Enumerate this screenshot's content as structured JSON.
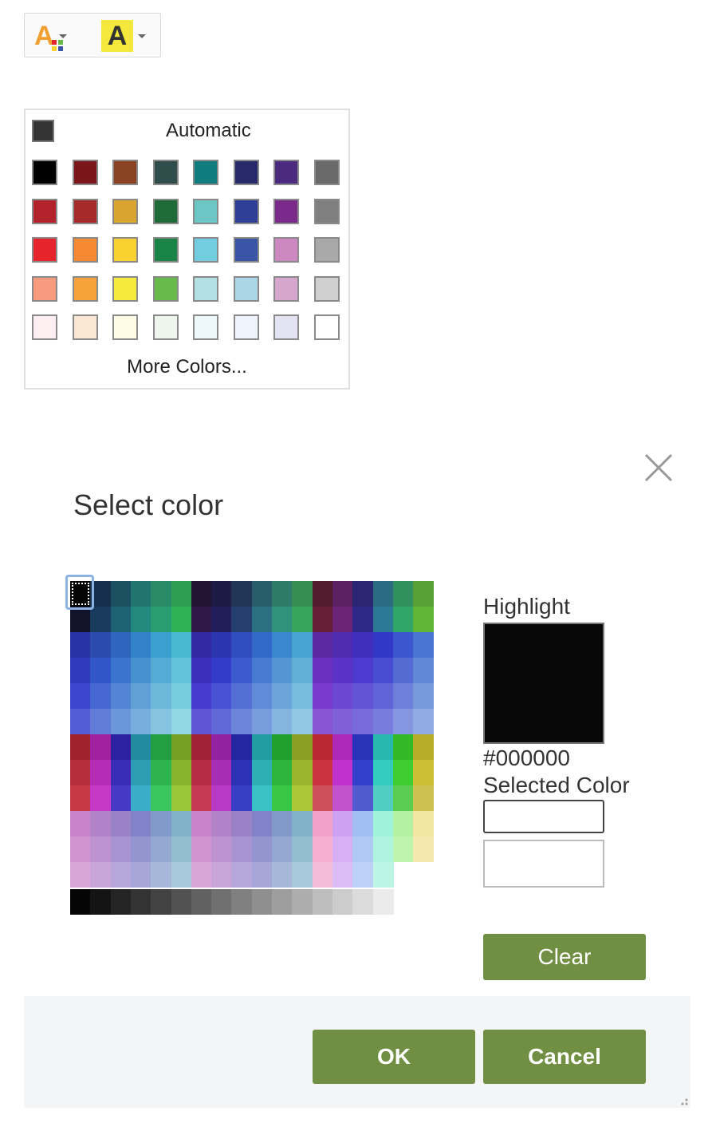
{
  "toolbar": {
    "buttons": [
      {
        "name": "font-color-button",
        "icon": "font-color-icon"
      },
      {
        "name": "highlight-color-button",
        "icon": "highlight-color-icon"
      }
    ]
  },
  "palette": {
    "automatic_label": "Automatic",
    "more_colors_label": "More Colors...",
    "rows": [
      [
        "#000000",
        "#7a1519",
        "#8a4322",
        "#2f4d4a",
        "#0f7d7e",
        "#262a6b",
        "#4b2b7d",
        "#6a6a6a"
      ],
      [
        "#b3232b",
        "#a52a2a",
        "#d9a430",
        "#1e6b38",
        "#6cc7c4",
        "#2f3f97",
        "#7a2a8a",
        "#808080"
      ],
      [
        "#e6242b",
        "#f58a33",
        "#f9d232",
        "#1a8447",
        "#73cde0",
        "#3a55a5",
        "#cd88c2",
        "#a9a9a9"
      ],
      [
        "#f69b7e",
        "#f7a23b",
        "#f5eb3c",
        "#67bb4b",
        "#b5e0e3",
        "#acd5e6",
        "#d7a6ce",
        "#d0d0d0"
      ],
      [
        "#fdeef2",
        "#fbe6d3",
        "#fefbe4",
        "#eef5ec",
        "#eef8fb",
        "#eef4fb",
        "#e3e3f3",
        "#ffffff"
      ]
    ]
  },
  "dialog": {
    "title": "Select color",
    "highlight_label": "Highlight",
    "highlight_color": "#080808",
    "hex_value": "#000000",
    "selected_color_label": "Selected Color",
    "selected_color_value": "",
    "clear_label": "Clear",
    "ok_label": "OK",
    "cancel_label": "Cancel",
    "accent_color": "#718f43"
  }
}
